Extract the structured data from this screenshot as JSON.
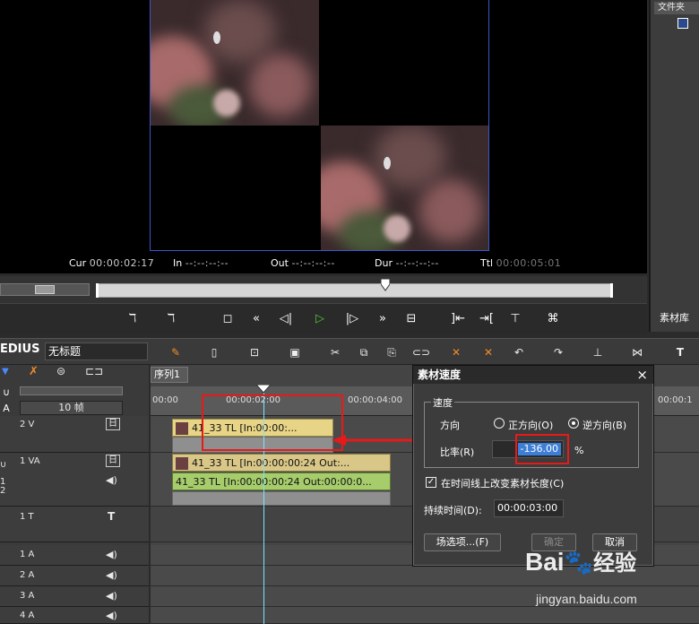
{
  "player": {
    "cur_label": "Cur",
    "cur_value": "00:00:02:17",
    "in_label": "In",
    "in_value": "--:--:--:--",
    "out_label": "Out",
    "out_value": "--:--:--:--",
    "dur_label": "Dur",
    "dur_value": "--:--:--:--",
    "ttl_label": "Ttl",
    "ttl_value": "00:00:05:01",
    "scrub_position": 0.56
  },
  "bin": {
    "folder_label": "文件夹",
    "tab_label": "素材库"
  },
  "app": {
    "name": "EDIUS",
    "project_title": "无标题"
  },
  "track_header": {
    "scale_label": "10 帧",
    "tracks": [
      {
        "name": "2 V",
        "type": "video"
      },
      {
        "name": "1 VA",
        "type": "videoaudio"
      },
      {
        "name": "1 T",
        "type": "title"
      },
      {
        "name": "1 A",
        "type": "audio"
      },
      {
        "name": "2 A",
        "type": "audio"
      },
      {
        "name": "3 A",
        "type": "audio"
      },
      {
        "name": "4 A",
        "type": "audio"
      }
    ],
    "side_label": "1 2"
  },
  "timeline": {
    "sequence_tab": "序列1",
    "ruler": [
      "00:00",
      "00:00:02:00",
      "00:00:04:00",
      "00:00:1"
    ],
    "clips": {
      "v2_clip": "41_33  TL [In:00:00:...",
      "va1_video": "41_33  TL [In:00:00:00:24 Out:...",
      "va1_audio": "41_33  TL [In:00:00:00:24 Out:00:00:0..."
    }
  },
  "dialog": {
    "title": "素材速度",
    "close": "×",
    "group_label": "速度",
    "direction_label": "方向",
    "forward_label": "正方向(O)",
    "reverse_label": "逆方向(B)",
    "reverse_selected": true,
    "rate_label": "比率(R)",
    "rate_value": "-136.00",
    "rate_unit": "%",
    "change_length_label": "在时间线上改变素材长度(C)",
    "change_length_checked": true,
    "duration_label": "持续时间(D):",
    "duration_value": "00:00:03:00",
    "field_options_button": "场选项...(F)",
    "ok_button": "确定",
    "cancel_button": "取消"
  },
  "watermark": {
    "brand": "Bai",
    "brand_suffix": "经验",
    "url": "jingyan.baidu.com"
  },
  "colors": {
    "accent_blue": "#3a56c8",
    "highlight_red": "#e81919",
    "clip_yellow": "#e7d486",
    "clip_green": "#a6cc6c",
    "rate_field": "#3d7fd6"
  }
}
